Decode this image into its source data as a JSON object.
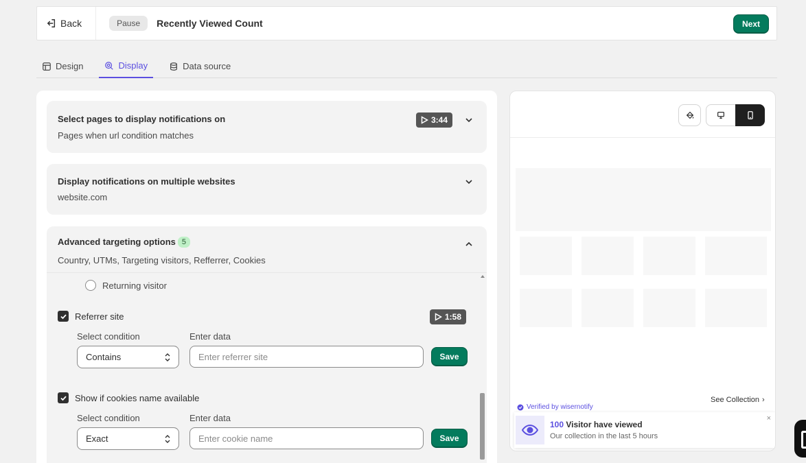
{
  "header": {
    "back_label": "Back",
    "status": "Pause",
    "title": "Recently Viewed Count",
    "next_label": "Next"
  },
  "tabs": [
    {
      "label": "Design",
      "icon": "design-icon",
      "active": false
    },
    {
      "label": "Display",
      "icon": "display-icon",
      "active": true
    },
    {
      "label": "Data source",
      "icon": "database-icon",
      "active": false
    }
  ],
  "sections": {
    "pages": {
      "title": "Select pages to display notifications on",
      "subtitle": "Pages when url condition matches",
      "video": "3:44"
    },
    "websites": {
      "title": "Display notifications on multiple websites",
      "subtitle": "website.com"
    },
    "advanced": {
      "title": "Advanced targeting options",
      "count": "5",
      "subtitle": "Country, UTMs, Targeting visitors, Refferrer, Cookies"
    }
  },
  "advanced_options": {
    "returning_visitor": "Returning visitor",
    "referrer": {
      "label": "Referrer site",
      "checked": true,
      "video": "1:58",
      "condition_label": "Select condition",
      "condition_value": "Contains",
      "data_label": "Enter data",
      "placeholder": "Enter referrer site",
      "save_label": "Save"
    },
    "cookies": {
      "label": "Show if cookies name available",
      "checked": true,
      "condition_label": "Select condition",
      "condition_value": "Exact",
      "data_label": "Enter data",
      "placeholder": "Enter cookie name",
      "save_label": "Save"
    }
  },
  "preview": {
    "verified": "Verified by wisernotify",
    "see_collection": "See Collection",
    "notification": {
      "count": "100",
      "title_rest": " Visitor have viewed",
      "subtitle": "Our collection in the last 5 hours"
    },
    "colors": {
      "accent": "#5b4fe0",
      "primary_button": "#047b5d"
    }
  }
}
